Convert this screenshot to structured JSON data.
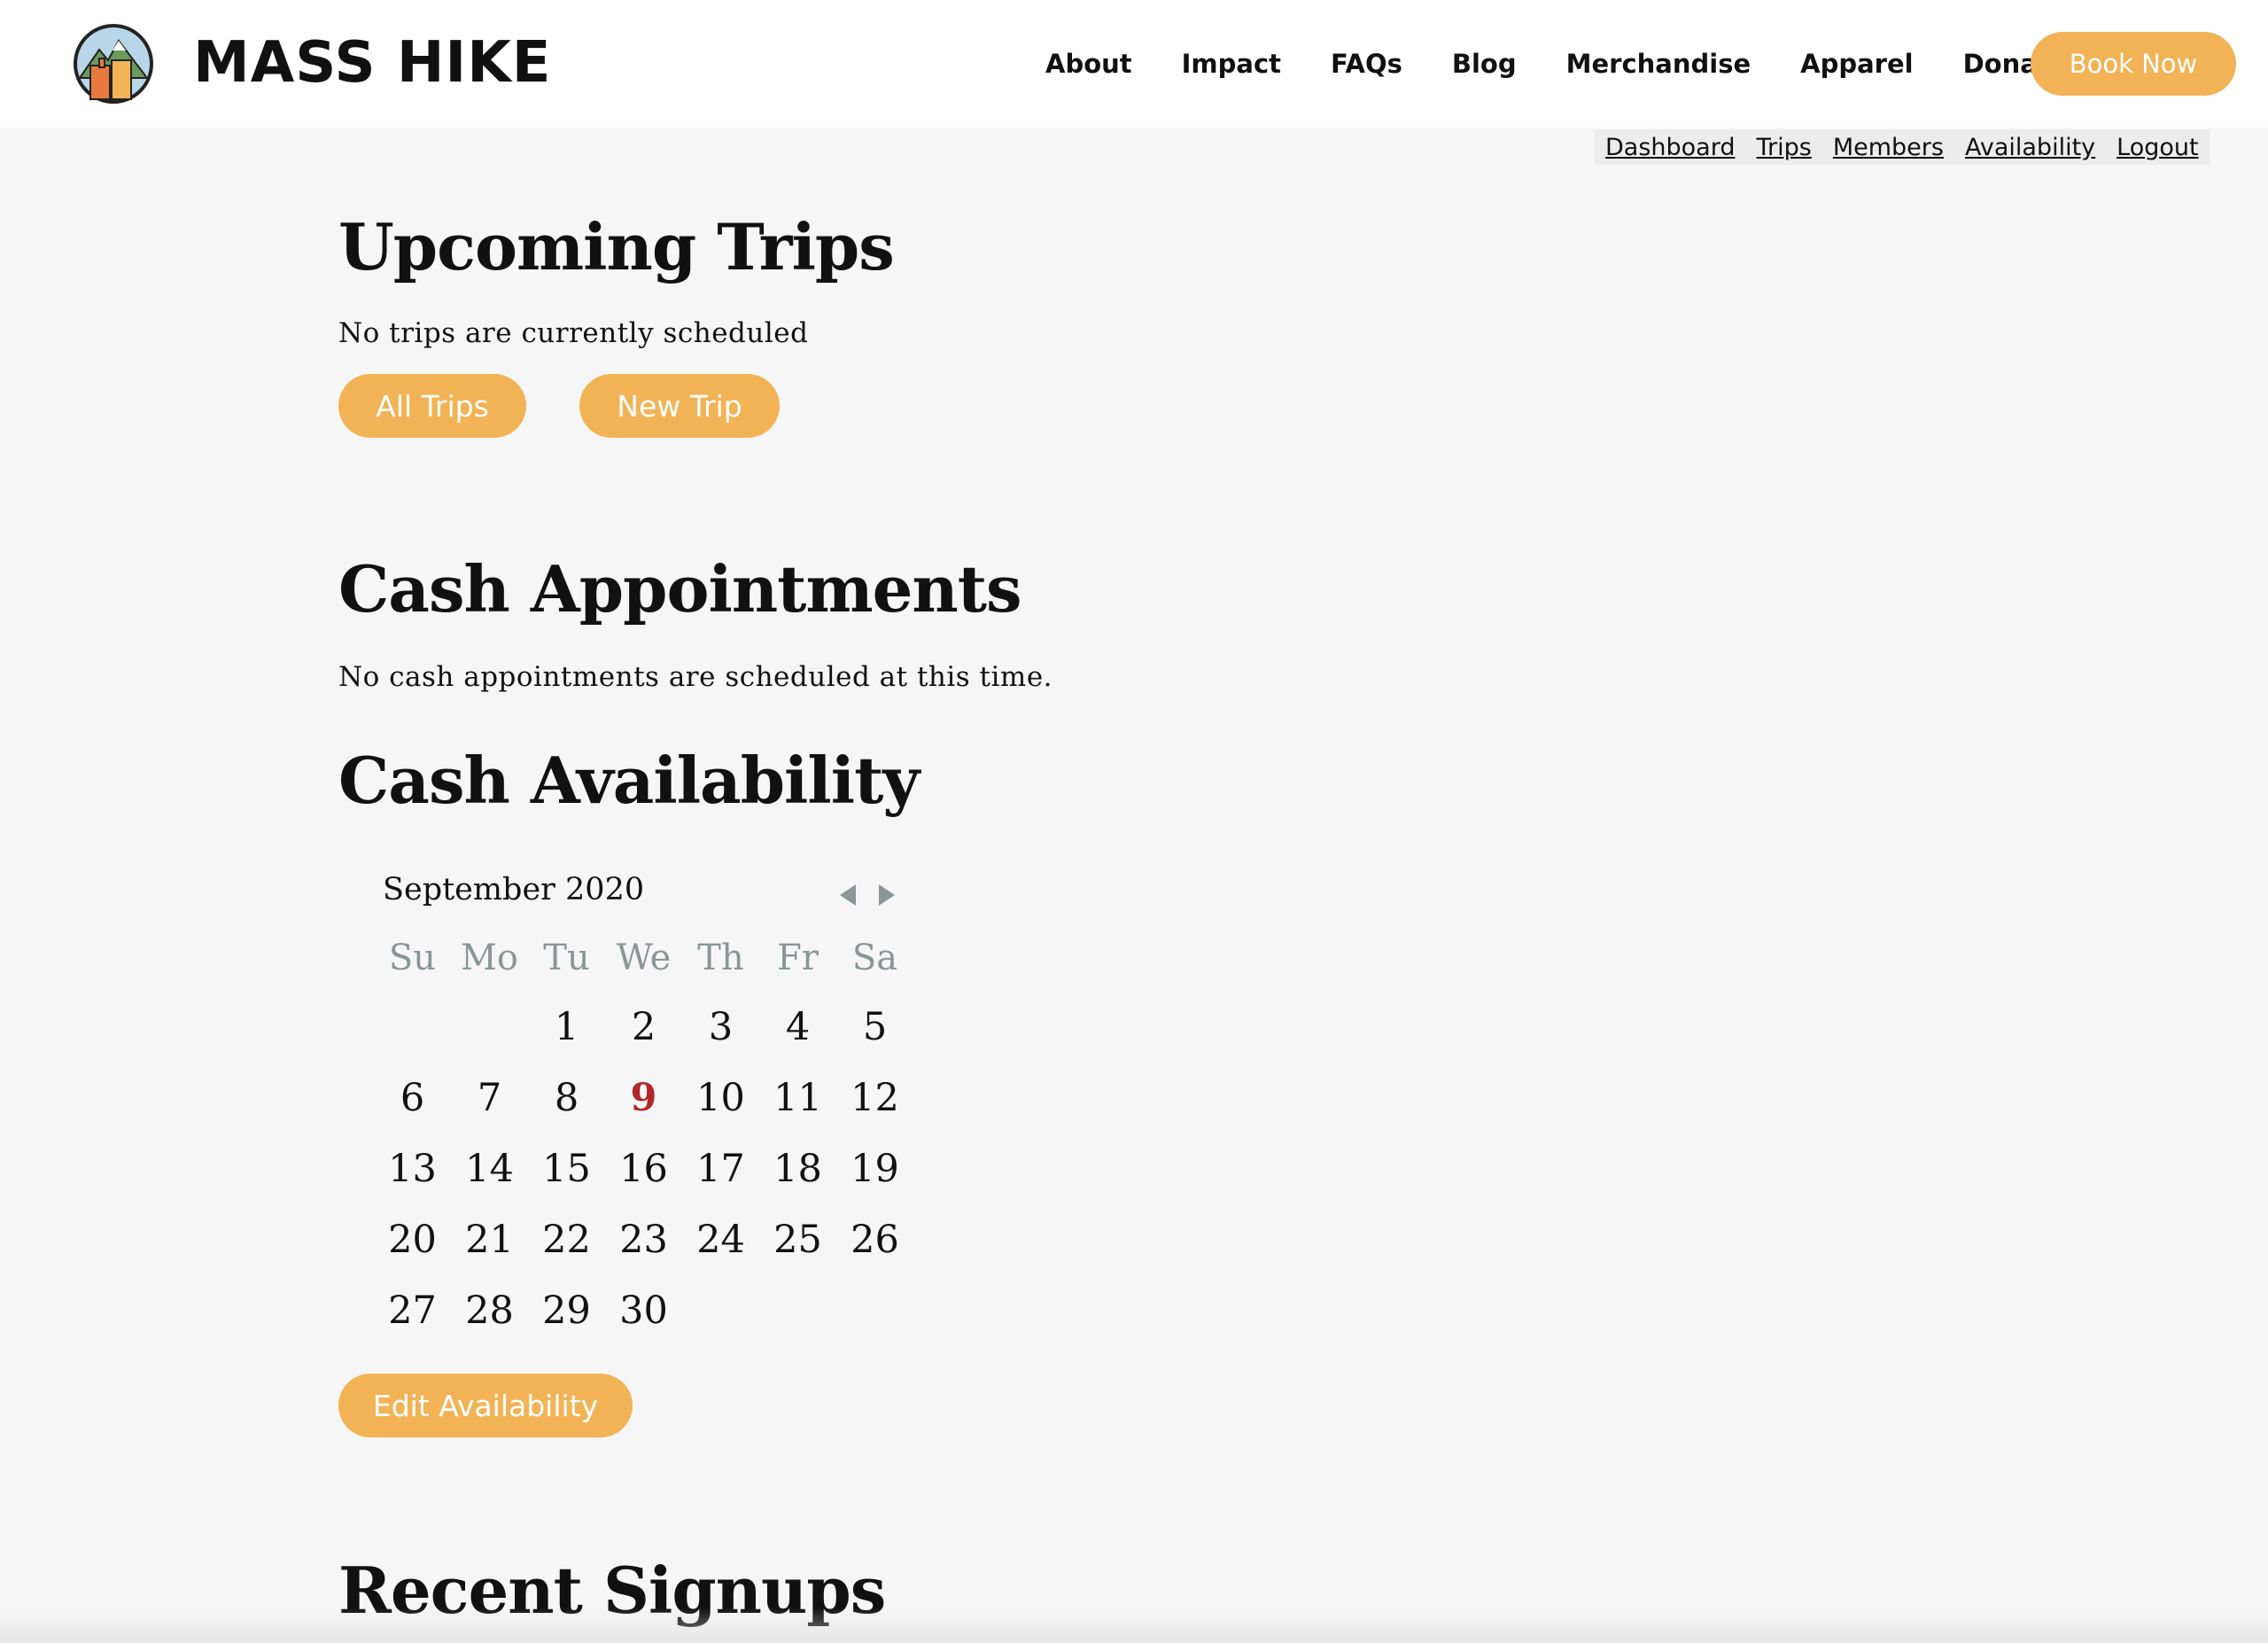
{
  "brand": {
    "name": "MASS HIKE",
    "logo_icon": "mountain-logo-icon"
  },
  "nav": {
    "items": [
      "About",
      "Impact",
      "FAQs",
      "Blog",
      "Merchandise",
      "Apparel",
      "Donate"
    ],
    "cta": "Book Now"
  },
  "subnav": {
    "items": [
      "Dashboard",
      "Trips",
      "Members",
      "Availability",
      "Logout"
    ]
  },
  "upcoming": {
    "title": "Upcoming Trips",
    "empty": "No trips are currently scheduled",
    "all_trips": "All Trips",
    "new_trip": "New Trip"
  },
  "cash_appointments": {
    "title": "Cash Appointments",
    "empty": "No cash appointments are scheduled at this time."
  },
  "cash_availability": {
    "title": "Cash Availability",
    "edit_button": "Edit Availability"
  },
  "calendar": {
    "month_label": "September 2020",
    "weekdays": [
      "Su",
      "Mo",
      "Tu",
      "We",
      "Th",
      "Fr",
      "Sa"
    ],
    "weeks": [
      [
        "",
        "",
        "1",
        "2",
        "3",
        "4",
        "5"
      ],
      [
        "6",
        "7",
        "8",
        "9",
        "10",
        "11",
        "12"
      ],
      [
        "13",
        "14",
        "15",
        "16",
        "17",
        "18",
        "19"
      ],
      [
        "20",
        "21",
        "22",
        "23",
        "24",
        "25",
        "26"
      ],
      [
        "27",
        "28",
        "29",
        "30",
        "",
        "",
        ""
      ]
    ],
    "today": "9",
    "colors": {
      "accent": "#f2b356",
      "today": "#b22727",
      "weekday": "#8b9696"
    }
  },
  "recent_signups": {
    "title": "Recent Signups"
  }
}
